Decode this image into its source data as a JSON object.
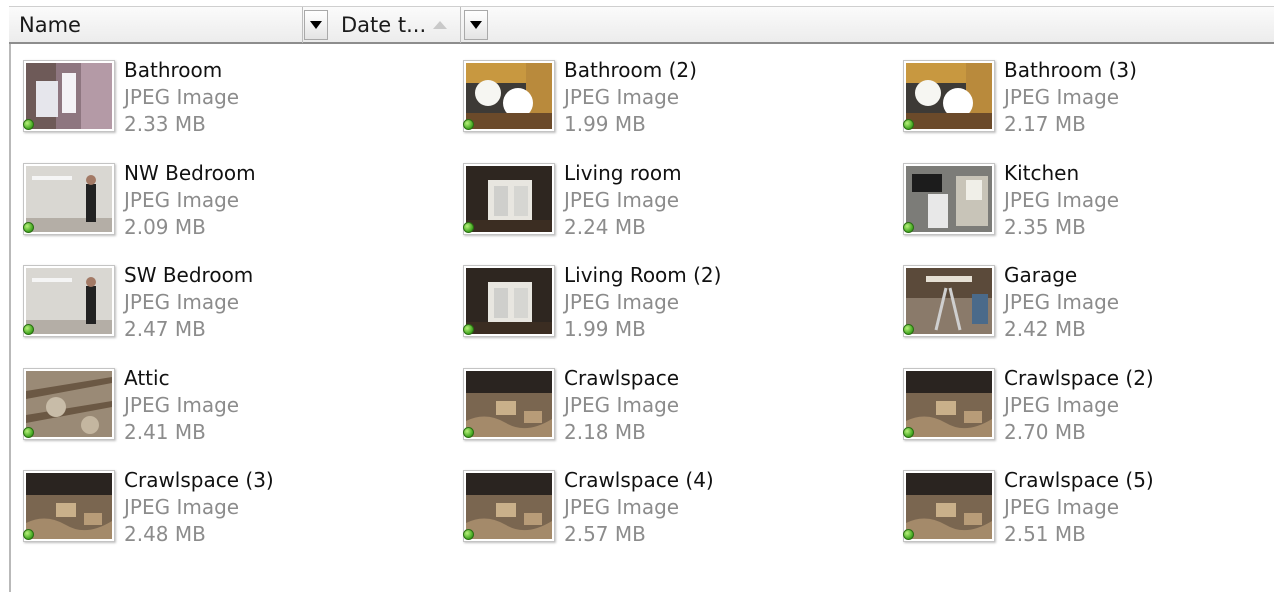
{
  "header": {
    "columns": [
      {
        "label": "Name"
      },
      {
        "label": "Date t..."
      }
    ]
  },
  "items": [
    {
      "name": "Bathroom",
      "type": "JPEG Image",
      "size": "2.33 MB",
      "thumb": "bathroom-photo"
    },
    {
      "name": "Bathroom (2)",
      "type": "JPEG Image",
      "size": "1.99 MB",
      "thumb": "bathroom-lights-photo"
    },
    {
      "name": "Bathroom (3)",
      "type": "JPEG Image",
      "size": "2.17 MB",
      "thumb": "bathroom-lights-photo"
    },
    {
      "name": "NW Bedroom",
      "type": "JPEG Image",
      "size": "2.09 MB",
      "thumb": "bedroom-photo"
    },
    {
      "name": "Living room",
      "type": "JPEG Image",
      "size": "2.24 MB",
      "thumb": "living-room-photo"
    },
    {
      "name": "Kitchen",
      "type": "JPEG Image",
      "size": "2.35 MB",
      "thumb": "kitchen-photo"
    },
    {
      "name": "SW Bedroom",
      "type": "JPEG Image",
      "size": "2.47 MB",
      "thumb": "bedroom-photo"
    },
    {
      "name": "Living Room (2)",
      "type": "JPEG Image",
      "size": "1.99 MB",
      "thumb": "living-room-photo"
    },
    {
      "name": "Garage",
      "type": "JPEG Image",
      "size": "2.42 MB",
      "thumb": "garage-photo"
    },
    {
      "name": "Attic",
      "type": "JPEG Image",
      "size": "2.41 MB",
      "thumb": "attic-photo"
    },
    {
      "name": "Crawlspace",
      "type": "JPEG Image",
      "size": "2.18 MB",
      "thumb": "crawlspace-photo"
    },
    {
      "name": "Crawlspace (2)",
      "type": "JPEG Image",
      "size": "2.70 MB",
      "thumb": "crawlspace-photo"
    },
    {
      "name": "Crawlspace (3)",
      "type": "JPEG Image",
      "size": "2.48 MB",
      "thumb": "crawlspace-photo"
    },
    {
      "name": "Crawlspace (4)",
      "type": "JPEG Image",
      "size": "2.57 MB",
      "thumb": "crawlspace-photo"
    },
    {
      "name": "Crawlspace (5)",
      "type": "JPEG Image",
      "size": "2.51 MB",
      "thumb": "crawlspace-photo"
    }
  ],
  "colors": {
    "status_dot": "#3fa51e",
    "secondary_text": "#8c8c8c"
  }
}
